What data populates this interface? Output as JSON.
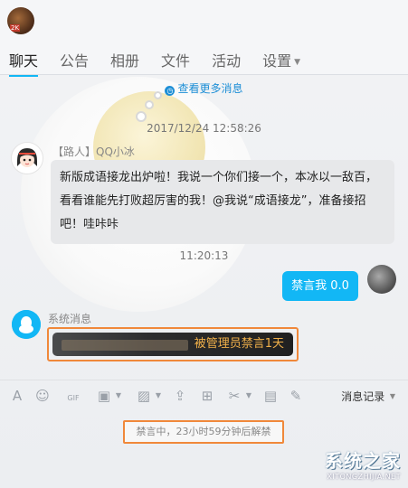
{
  "header": {
    "avatar_tag": "2K",
    "tabs": [
      {
        "label": "聊天"
      },
      {
        "label": "公告"
      },
      {
        "label": "相册"
      },
      {
        "label": "文件"
      },
      {
        "label": "活动"
      },
      {
        "label": "设置"
      }
    ]
  },
  "chat": {
    "more_messages": "查看更多消息",
    "timestamp1": "2017/12/24 12:58:26",
    "bot": {
      "sender": "【路人】QQ小冰",
      "message": "新版成语接龙出炉啦！我说一个你们接一个，本冰以一敌百，看看谁能先打败超厉害的我！@我说“成语接龙”，准备接招吧！哇咔咔"
    },
    "timestamp2": "11:20:13",
    "my_message": "禁言我 0.0",
    "system": {
      "label": "系统消息",
      "message": "被管理员禁言1天"
    }
  },
  "toolbar": {
    "history_label": "消息记录"
  },
  "input": {
    "mute_notice": "禁言中，23小时59分钟后解禁"
  },
  "watermark": {
    "title": "系统之家",
    "url": "XITONGZHIJIA.NET"
  },
  "colors": {
    "accent": "#12b7f5",
    "highlight_border": "#f0883a"
  }
}
